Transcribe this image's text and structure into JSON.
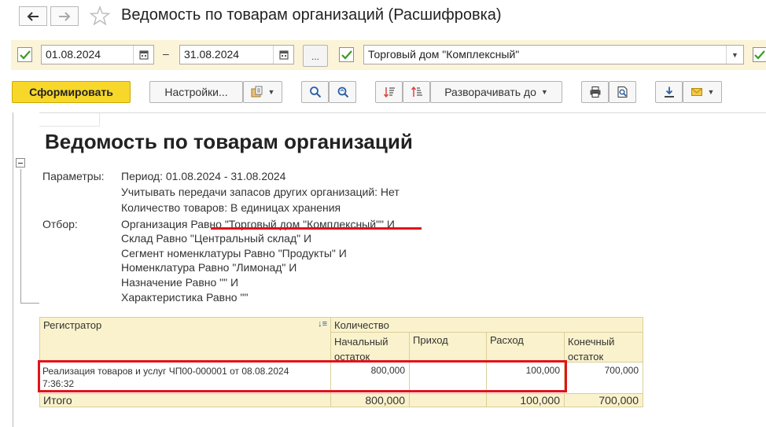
{
  "window": {
    "title": "Ведомость по товарам организаций (Расшифровка)",
    "back_icon": "arrow-left-icon",
    "forward_icon": "arrow-right-icon",
    "favorite_icon": "star-icon"
  },
  "params": {
    "date_from": "01.08.2024",
    "date_sep": "–",
    "date_to": "31.08.2024",
    "period_button": "...",
    "organization": "Торговый дом \"Комплексный\"",
    "date_from_checked": true,
    "organization_checked": true
  },
  "toolbar": {
    "generate": "Сформировать",
    "settings": "Настройки...",
    "expand_to": "Разворачивать до"
  },
  "report": {
    "title": "Ведомость по товарам организаций",
    "params_label": "Параметры:",
    "params": [
      "Период: 01.08.2024 - 31.08.2024",
      "Учитывать передачи запасов других организаций: Нет",
      "Количество товаров: В единицах хранения"
    ],
    "filter_label": "Отбор:",
    "filters": [
      "Организация Равно \"Торговый дом \"Комплексный\"\" И",
      "Склад Равно \"Центральный склад\" И",
      "Сегмент номенклатуры Равно \"Продукты\" И",
      "Номенклатура Равно \"Лимонад\" И",
      "Назначение Равно \"\" И",
      "Характеристика Равно \"\""
    ]
  },
  "table": {
    "col_registrar": "Регистратор",
    "col_group": "Количество",
    "col_start": "Начальный остаток",
    "col_in": "Приход",
    "col_out": "Расход",
    "col_end": "Конечный остаток",
    "row": {
      "registrar_line1": "Реализация товаров и услуг ЧП00-000001 от 08.08.2024",
      "registrar_line2": "7:36:32",
      "start": "800,000",
      "in": "",
      "out": "100,000",
      "end": "700,000"
    },
    "total": {
      "label": "Итого",
      "start": "800,000",
      "in": "",
      "out": "100,000",
      "end": "700,000"
    }
  },
  "colors": {
    "primary_button": "#f7d72a",
    "param_strip": "#fbf4d8",
    "table_header": "#faf2cc",
    "highlight": "#e0131b",
    "check": "#3a9b25"
  }
}
